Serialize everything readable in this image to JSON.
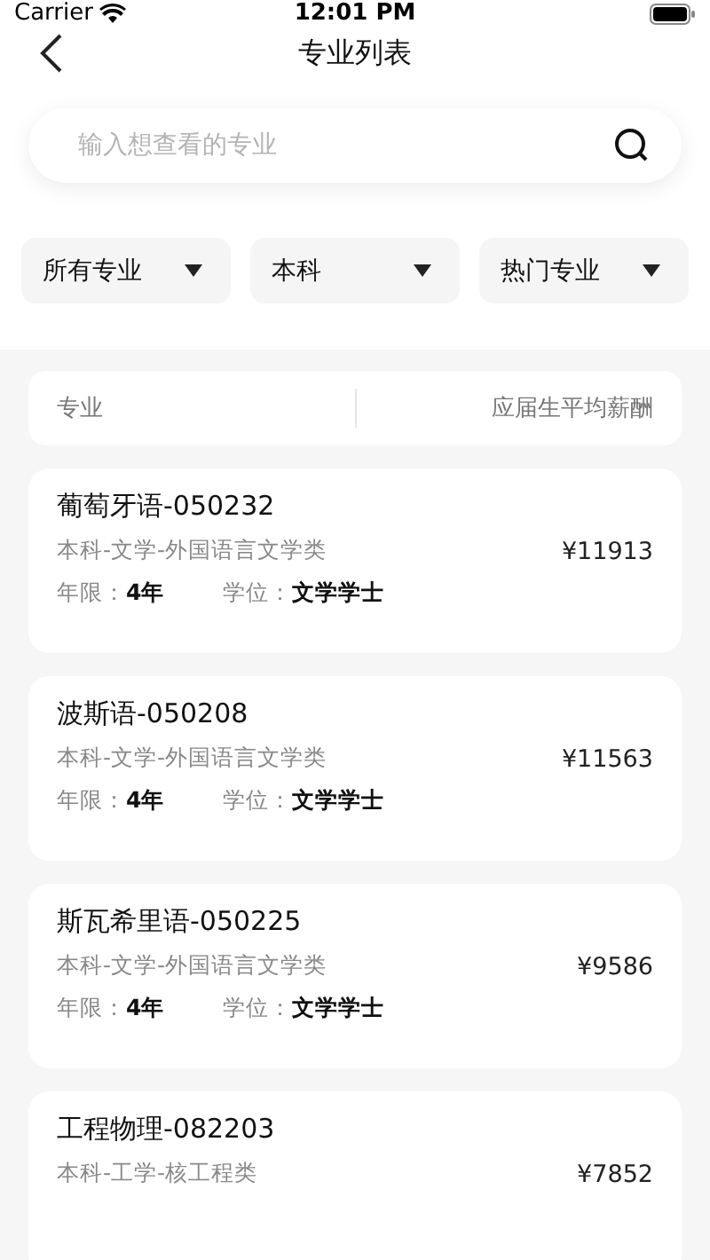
{
  "status_bar": {
    "carrier": "Carrier",
    "time": "12:01 PM"
  },
  "nav": {
    "title": "专业列表"
  },
  "search": {
    "placeholder": "输入想查看的专业"
  },
  "filters": [
    {
      "label": "所有专业"
    },
    {
      "label": "本科"
    },
    {
      "label": "热门专业"
    }
  ],
  "list_header": {
    "column_1": "专业",
    "column_2": "应届生平均薪酬"
  },
  "majors": [
    {
      "name": "葡萄牙语-050232",
      "category": "本科-文学-外国语言文学类",
      "salary": "¥11913",
      "details": [
        {
          "label": "年限：",
          "value": "4年"
        },
        {
          "label": "学位：",
          "value": "文学学士"
        }
      ]
    },
    {
      "name": "波斯语-050208",
      "category": "本科-文学-外国语言文学类",
      "salary": "¥11563",
      "details": [
        {
          "label": "年限：",
          "value": "4年"
        },
        {
          "label": "学位：",
          "value": "文学学士"
        }
      ]
    },
    {
      "name": "斯瓦希里语-050225",
      "category": "本科-文学-外国语言文学类",
      "salary": "¥9586",
      "details": [
        {
          "label": "年限：",
          "value": "4年"
        },
        {
          "label": "学位：",
          "value": "文学学士"
        }
      ]
    },
    {
      "name": "工程物理-082203",
      "category": "本科-工学-核工程类",
      "salary": "¥7852"
    }
  ]
}
